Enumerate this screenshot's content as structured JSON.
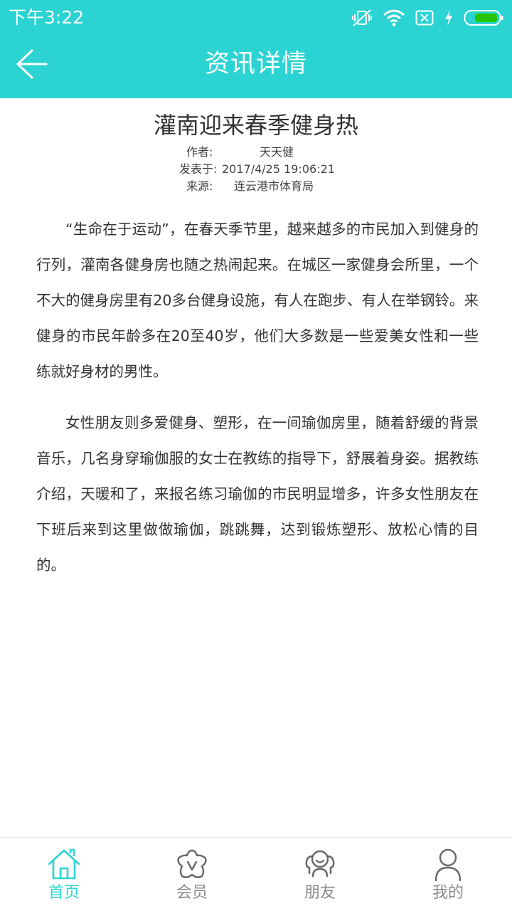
{
  "status_bar": {
    "time": "下午3:22"
  },
  "header": {
    "title": "资讯详情",
    "back_icon": "arrow-left-icon"
  },
  "article": {
    "title": "灌南迎来春季健身热",
    "author_label": "作者:",
    "author": "天天健",
    "date_label": "发表于:",
    "date": "2017/4/25 19:06:21",
    "source_label": "来源:",
    "source": "连云港市体育局",
    "paragraphs": [
      "“生命在于运动”，在春天季节里，越来越多的市民加入到健身的行列，灌南各健身房也随之热闹起来。在城区一家健身会所里，一个不大的健身房里有20多台健身设施，有人在跑步、有人在举钢铃。来健身的市民年龄多在20至40岁，他们大多数是一些爱美女性和一些练就好身材的男性。",
      "女性朋友则多爱健身、塑形，在一间瑜伽房里，随着舒缓的背景音乐，几名身穿瑜伽服的女士在教练的指导下，舒展着身姿。据教练介绍，天暖和了，来报名练习瑜伽的市民明显增多，许多女性朋友在下班后来到这里做做瑜伽，跳跳舞，达到锻炼塑形、放松心情的目的。"
    ]
  },
  "bottom_nav": {
    "items": [
      {
        "label": "首页",
        "icon": "home-icon",
        "active": true
      },
      {
        "label": "会员",
        "icon": "star-member-icon",
        "active": false
      },
      {
        "label": "朋友",
        "icon": "friends-icon",
        "active": false
      },
      {
        "label": "我的",
        "icon": "user-icon",
        "active": false
      }
    ]
  },
  "colors": {
    "brand": "#2bd3d3",
    "text": "#333333",
    "nav_inactive": "#8a8a8a",
    "battery": "#27c400"
  }
}
